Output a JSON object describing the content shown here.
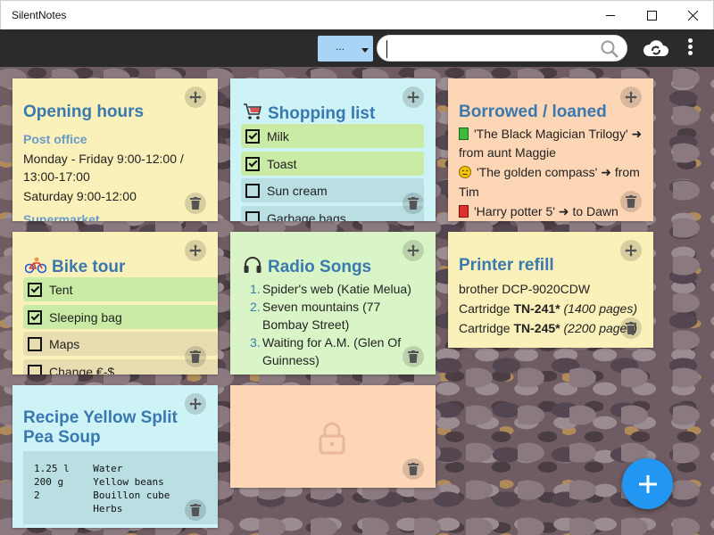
{
  "window": {
    "title": "SilentNotes"
  },
  "toolbar": {
    "filter_label": "...",
    "search_value": ""
  },
  "notes": {
    "opening": {
      "title": "Opening hours",
      "subheading": "Post office",
      "line1": "Monday - Friday 9:00-12:00 / 13:00-17:00",
      "line2": "Saturday 9:00-12:00",
      "subheading2": "Supermarket"
    },
    "shopping": {
      "title": "Shopping list",
      "items": [
        {
          "label": "Milk",
          "checked": true
        },
        {
          "label": "Toast",
          "checked": true
        },
        {
          "label": "Sun cream",
          "checked": false
        },
        {
          "label": "Garbage bags",
          "checked": false
        }
      ]
    },
    "borrowed": {
      "title": "Borrowed / loaned",
      "entries": [
        {
          "item": "'The Black Magician Trilogy'",
          "arrow": "➜",
          "rest": "from aunt Maggie"
        },
        {
          "item": "'The golden compass'",
          "arrow": "➜",
          "rest": "from Tim"
        },
        {
          "item": "'Harry potter 5'",
          "arrow": "➜",
          "rest": "to Dawn"
        }
      ]
    },
    "bike": {
      "title": "Bike tour",
      "items": [
        {
          "label": "Tent",
          "checked": true
        },
        {
          "label": "Sleeping bag",
          "checked": true
        },
        {
          "label": "Maps",
          "checked": false
        },
        {
          "label": "Change €-$",
          "checked": false
        }
      ]
    },
    "radio": {
      "title": "Radio Songs",
      "songs": [
        {
          "num": "1.",
          "text": "Spider's web (Katie Melua)"
        },
        {
          "num": "2.",
          "text": "Seven mountains (77 Bombay Street)"
        },
        {
          "num": "3.",
          "text": "Waiting for A.M. (Glen Of Guinness)"
        }
      ]
    },
    "printer": {
      "title": "Printer refill",
      "model": "brother DCP-9020CDW",
      "line1_prefix": "Cartridge ",
      "line1_bold": "TN-241*",
      "line1_italic": "(1400 pages)",
      "line2_prefix": "Cartridge ",
      "line2_bold": "TN-245*",
      "line2_italic": "(2200 pages)"
    },
    "recipe": {
      "title": "Recipe Yellow Split Pea Soup",
      "ingredients": "1.25 l    Water\n200 g     Yellow beans\n2         Bouillon cube\n          Herbs"
    },
    "locked": {
      "icon": "lock-icon"
    }
  },
  "colors": {
    "accent": "#2196f3",
    "title_blue": "#3a78b0"
  }
}
